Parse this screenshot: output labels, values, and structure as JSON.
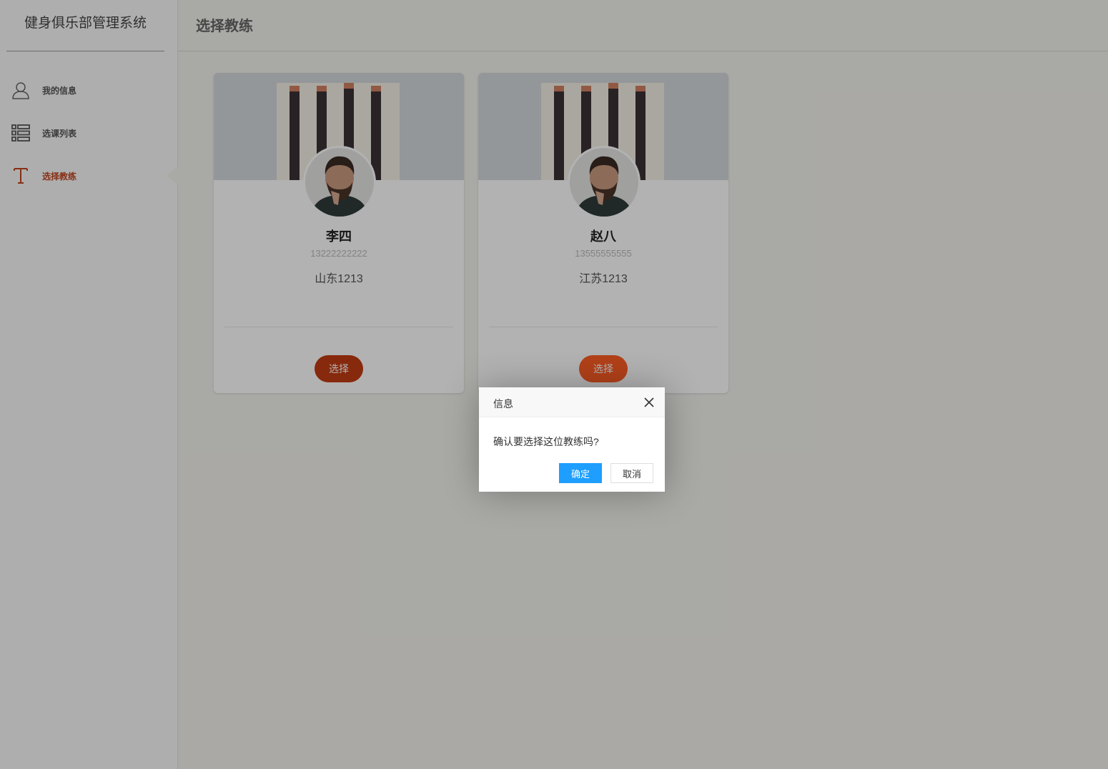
{
  "app": {
    "title": "健身俱乐部管理系统"
  },
  "sidebar": {
    "items": [
      {
        "label": "我的信息",
        "icon": "user-icon",
        "active": false
      },
      {
        "label": "选课列表",
        "icon": "list-icon",
        "active": false
      },
      {
        "label": "选择教练",
        "icon": "text-t-icon",
        "active": true
      }
    ]
  },
  "header": {
    "title": "选择教练"
  },
  "coaches": [
    {
      "name": "李四",
      "phone": "13222222222",
      "address": "山东1213",
      "button_label": "选择",
      "button_color": "#c23b12"
    },
    {
      "name": "赵八",
      "phone": "13555555555",
      "address": "江苏1213",
      "button_label": "选择",
      "button_color": "#ff5e24"
    }
  ],
  "dialog": {
    "title": "信息",
    "message": "确认要选择这位教练吗?",
    "ok_label": "确定",
    "cancel_label": "取消",
    "ok_color": "#1e9fff"
  },
  "colors": {
    "accent": "#c1441e",
    "background": "#f3f2ee",
    "sidebar": "#fafafa"
  }
}
